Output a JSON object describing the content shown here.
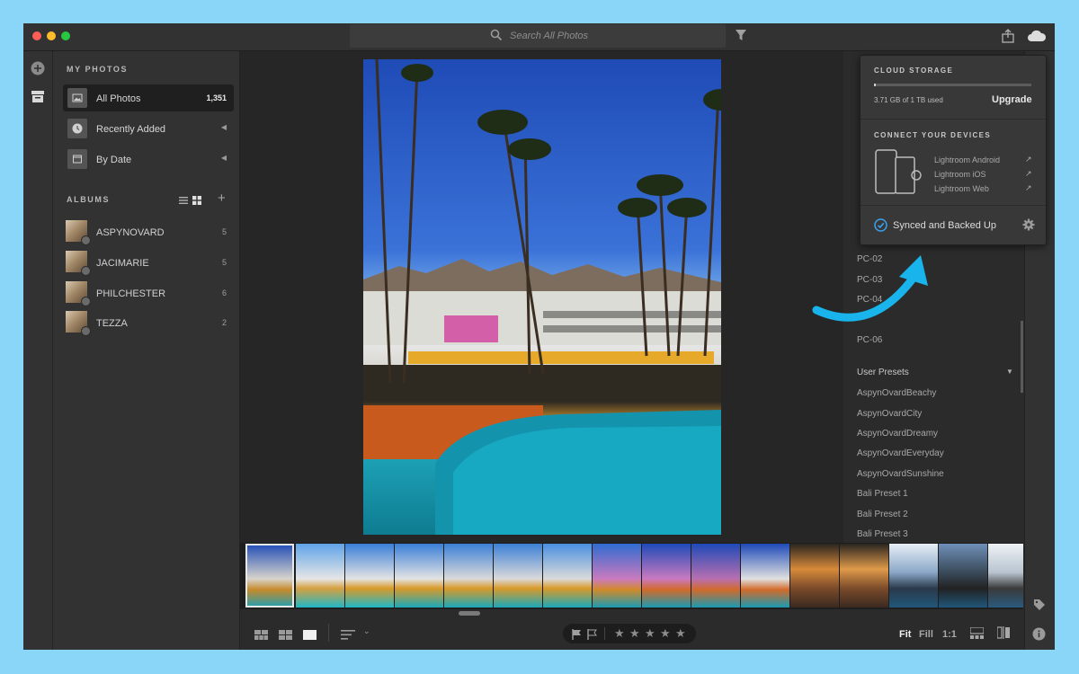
{
  "search": {
    "placeholder": "Search All Photos"
  },
  "sidebar": {
    "my_photos_title": "MY PHOTOS",
    "items": [
      {
        "label": "All Photos",
        "count": "1,351"
      },
      {
        "label": "Recently Added"
      },
      {
        "label": "By Date"
      }
    ],
    "albums_title": "ALBUMS",
    "albums": [
      {
        "label": "ASPYNOVARD",
        "count": "5"
      },
      {
        "label": "JACIMARIE",
        "count": "5"
      },
      {
        "label": "PHILCHESTER",
        "count": "6"
      },
      {
        "label": "TEZZA",
        "count": "2"
      }
    ]
  },
  "cloud": {
    "title": "CLOUD STORAGE",
    "used": "3.71 GB of 1 TB used",
    "upgrade": "Upgrade",
    "storage_used_fraction": 0.0037,
    "connect_title": "CONNECT YOUR DEVICES",
    "devices": [
      "Lightroom Android",
      "Lightroom iOS",
      "Lightroom Web"
    ],
    "status": "Synced and Backed Up"
  },
  "presets": {
    "pc_items": [
      "PC-02",
      "PC-03",
      "PC-04",
      "PC-06"
    ],
    "user_presets_title": "User Presets",
    "user_presets": [
      "AspynOvardBeachy",
      "AspynOvardCity",
      "AspynOvardDreamy",
      "AspynOvardEveryday",
      "AspynOvardSunshine",
      "Bali Preset 1",
      "Bali Preset 2",
      "Bali Preset 3"
    ]
  },
  "bottombar": {
    "zoom_options": [
      "Fit",
      "Fill",
      "1:1"
    ]
  },
  "colors": {
    "arrow": "#19b4ec",
    "accent": "#3aa3f2",
    "background": "#8ad6f9"
  }
}
